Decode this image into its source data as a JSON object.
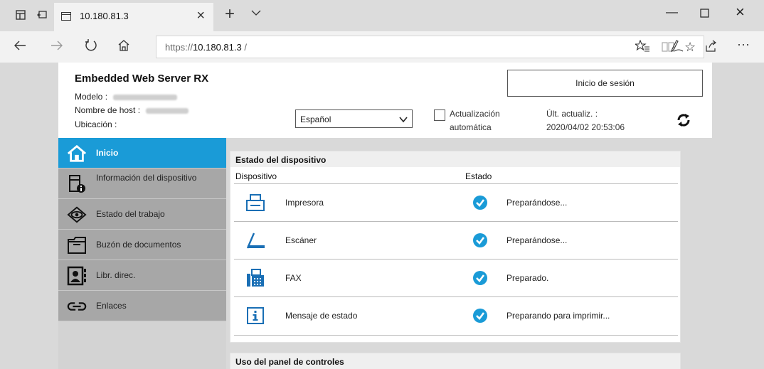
{
  "browser": {
    "tab_title": "10.180.81.3",
    "url_prefix": "https://",
    "url_host": "10.180.81.3",
    "url_suffix": " /"
  },
  "header": {
    "app_name": "Embedded Web Server RX",
    "model_label": "Modelo :",
    "host_label": "Nombre de host :",
    "location_label": "Ubicación :",
    "language": "Español",
    "auto_update_line1": "Actualización",
    "auto_update_line2": "automática",
    "last_update_label": "Últ. actualiz. :",
    "last_update_value": "2020/04/02 20:53:06",
    "login_button": "Inicio de sesión"
  },
  "sidebar": {
    "items": [
      {
        "label": "Inicio",
        "icon": "home-icon"
      },
      {
        "label": "Información del dispositivo",
        "icon": "device-info-icon"
      },
      {
        "label": "Estado del trabajo",
        "icon": "eye-icon"
      },
      {
        "label": "Buzón de documentos",
        "icon": "folder-icon"
      },
      {
        "label": "Libr. direc.",
        "icon": "address-book-icon"
      },
      {
        "label": "Enlaces",
        "icon": "link-icon"
      }
    ]
  },
  "device_status": {
    "title": "Estado del dispositivo",
    "col_device": "Dispositivo",
    "col_status": "Estado",
    "rows": [
      {
        "name": "Impresora",
        "status": "Preparándose...",
        "icon": "printer-icon"
      },
      {
        "name": "Escáner",
        "status": "Preparándose...",
        "icon": "scanner-icon"
      },
      {
        "name": "FAX",
        "status": "Preparado.",
        "icon": "fax-icon"
      },
      {
        "name": "Mensaje de estado",
        "status": "Preparando para imprimir...",
        "icon": "info-icon"
      }
    ]
  },
  "panel_usage": {
    "title": "Uso del panel de controles"
  },
  "colors": {
    "accent": "#1a9bd7",
    "sidebar_item": "#a7a7a7",
    "check": "#1a9bd7"
  }
}
